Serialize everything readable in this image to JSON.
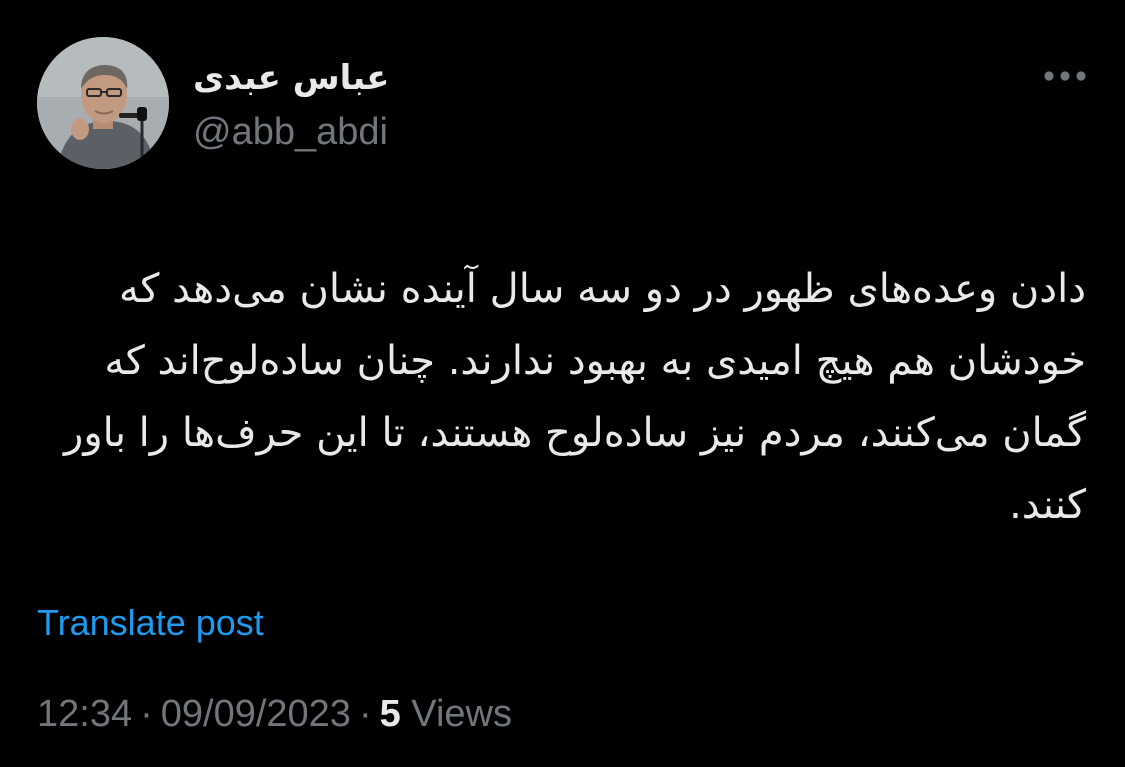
{
  "author": {
    "display_name": "عباس عبدی",
    "handle": "@abb_abdi",
    "avatar_icon": "user-avatar-photo"
  },
  "header": {
    "more_icon": "more-horizontal-icon"
  },
  "post": {
    "text": "دادن وعده‌های ظهور در دو سه سال آینده نشان می‌دهد که خودشان هم هیچ امیدی به بهبود ندارند. چنان ساده‌لوح‌اند که گمان می‌کنند، مردم نیز ساده‌لوح هستند، تا این حرف‌ها را باور کنند."
  },
  "actions": {
    "translate_label": "Translate post"
  },
  "meta": {
    "time": "12:34",
    "separator": "·",
    "date": "09/09/2023",
    "views_count": "5",
    "views_label": "Views"
  },
  "colors": {
    "background": "#000000",
    "primary_text": "#e7e9ea",
    "secondary_text": "#71767b",
    "link": "#1d9bf0"
  }
}
